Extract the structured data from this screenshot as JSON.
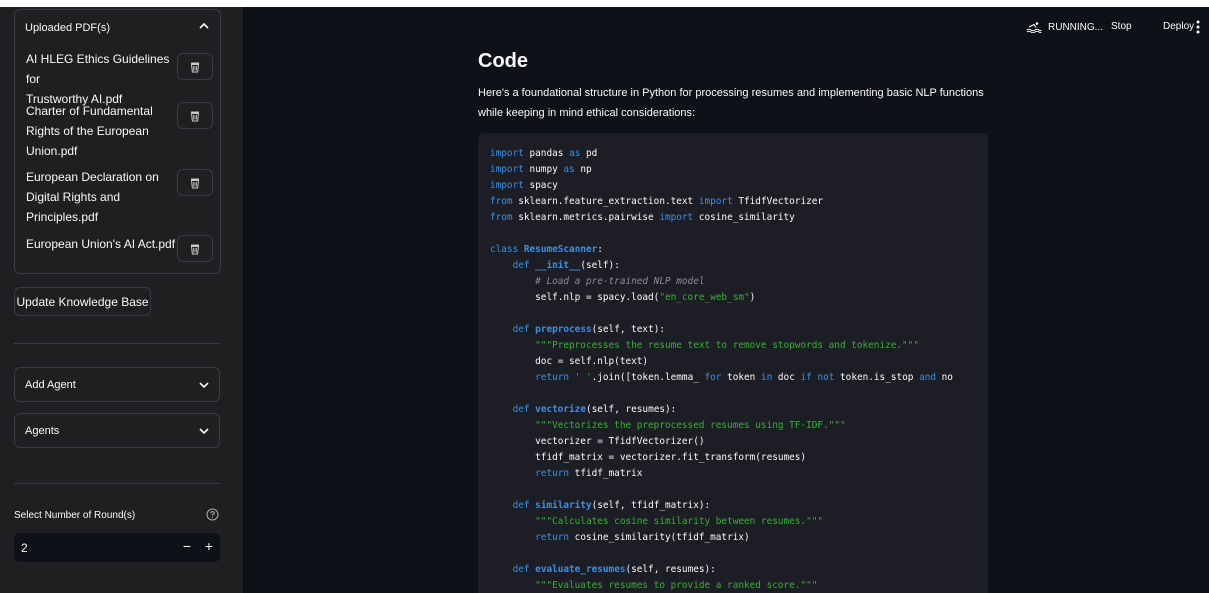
{
  "sidebar": {
    "uploaded_header": "Uploaded PDF(s)",
    "pdfs": [
      {
        "line1": "AI HLEG Ethics Guidelines for",
        "line2": "Trustworthy AI.pdf",
        "line3": ""
      },
      {
        "line1": "Charter of Fundamental",
        "line2": "Rights of the European",
        "line3": "Union.pdf"
      },
      {
        "line1": "European Declaration on",
        "line2": "Digital Rights and",
        "line3": "Principles.pdf"
      },
      {
        "line1": "European Union's AI Act.pdf",
        "line2": "",
        "line3": ""
      }
    ],
    "update_button": "Update Knowledge Base",
    "add_agent": "Add Agent",
    "agents": "Agents",
    "rounds_label": "Select Number of Round(s)",
    "rounds_value": "2",
    "minus": "−",
    "plus": "+"
  },
  "header": {
    "running": "RUNNING...",
    "stop": "Stop",
    "deploy": "Deploy"
  },
  "main": {
    "title": "Code",
    "paragraph": "Here's a foundational structure in Python for processing resumes and implementing basic NLP functions while keeping in mind ethical considerations:",
    "code_lines": [
      "import pandas as pd",
      "import numpy as np",
      "import spacy",
      "from sklearn.feature_extraction.text import TfidfVectorizer",
      "from sklearn.metrics.pairwise import cosine_similarity",
      "",
      "class ResumeScanner:",
      "    def __init__(self):",
      "        # Load a pre-trained NLP model",
      "        self.nlp = spacy.load(\"en_core_web_sm\")",
      "",
      "    def preprocess(self, text):",
      "        \"\"\"Preprocesses the resume text to remove stopwords and tokenize.\"\"\"",
      "        doc = self.nlp(text)",
      "        return ' '.join([token.lemma_ for token in doc if not token.is_stop and no",
      "",
      "    def vectorize(self, resumes):",
      "        \"\"\"Vectorizes the preprocessed resumes using TF-IDF.\"\"\"",
      "        vectorizer = TfidfVectorizer()",
      "        tfidf_matrix = vectorizer.fit_transform(resumes)",
      "        return tfidf_matrix",
      "",
      "    def similarity(self, tfidf_matrix):",
      "        \"\"\"Calculates cosine similarity between resumes.\"\"\"",
      "        return cosine_similarity(tfidf_matrix)",
      "",
      "    def evaluate_resumes(self, resumes):",
      "        \"\"\"Evaluates resumes to provide a ranked score.\"\"\""
    ]
  },
  "colors": {
    "sidebar_bg": "#1f1f22",
    "main_bg": "#0e1117",
    "code_bg": "#1d1e25",
    "keyword": "#3d8fe6",
    "string": "#33b233"
  }
}
